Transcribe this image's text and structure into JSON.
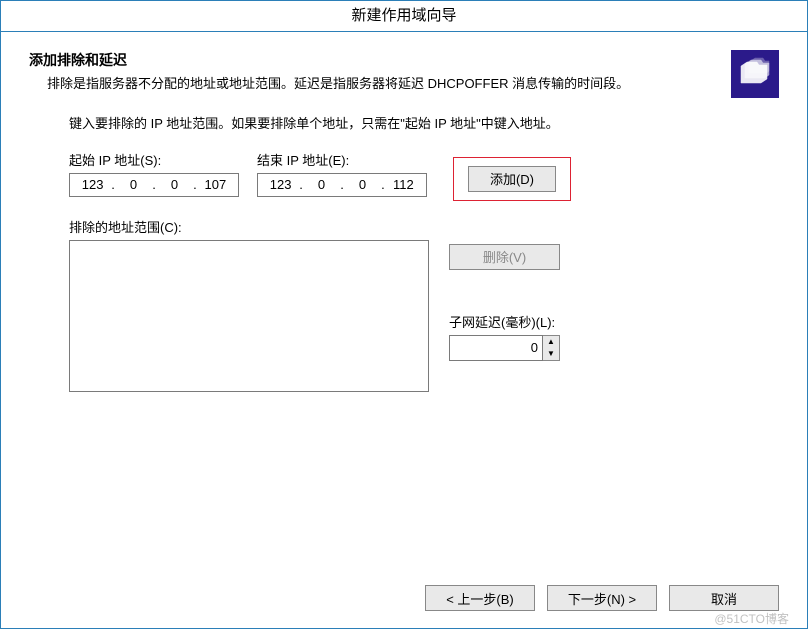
{
  "window": {
    "title": "新建作用域向导"
  },
  "section": {
    "heading": "添加排除和延迟",
    "description": "排除是指服务器不分配的地址或地址范围。延迟是指服务器将延迟 DHCPOFFER 消息传输的时间段。"
  },
  "instruction": "键入要排除的 IP 地址范围。如果要排除单个地址，只需在\"起始 IP 地址\"中键入地址。",
  "fields": {
    "start_label": "起始 IP 地址(S):",
    "start_ip": {
      "o1": "123",
      "o2": "0",
      "o3": "0",
      "o4": "107"
    },
    "end_label": "结束 IP 地址(E):",
    "end_ip": {
      "o1": "123",
      "o2": "0",
      "o3": "0",
      "o4": "112"
    }
  },
  "buttons": {
    "add": "添加(D)",
    "remove": "删除(V)",
    "back": "< 上一步(B)",
    "next": "下一步(N) >",
    "cancel": "取消"
  },
  "excluded": {
    "label": "排除的地址范围(C):",
    "items": []
  },
  "delay": {
    "label": "子网延迟(毫秒)(L):",
    "value": "0"
  },
  "icon": {
    "name": "folders-icon"
  },
  "watermark": "@51CTO博客"
}
